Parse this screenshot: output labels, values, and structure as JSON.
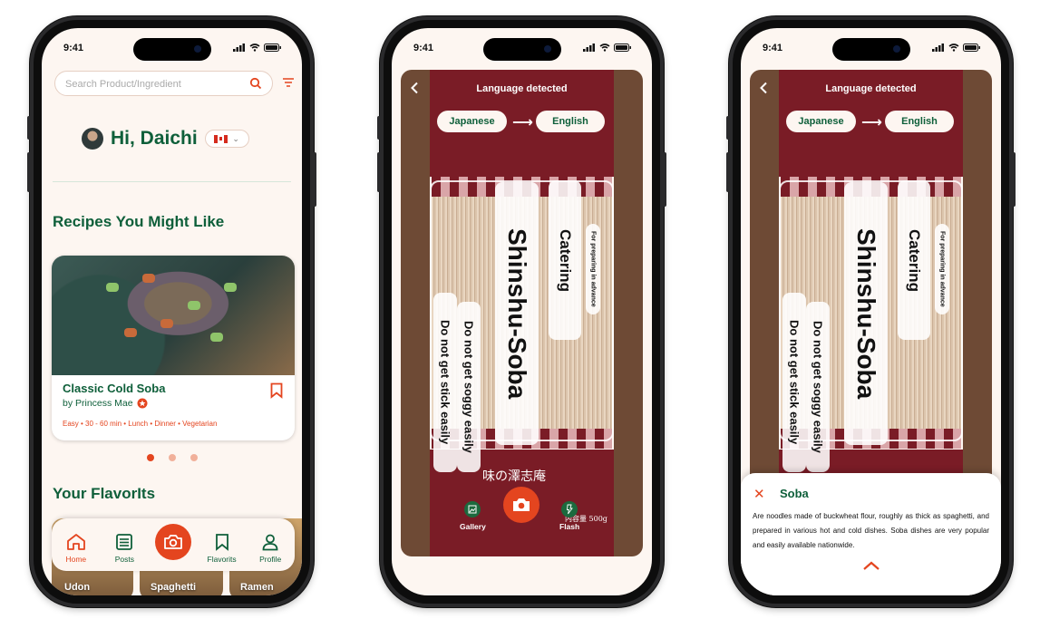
{
  "status": {
    "time": "9:41"
  },
  "home": {
    "search_placeholder": "Search Product/Ingredient",
    "greeting": "Hi, Daichi",
    "recipes_title": "Recipes You Might Like",
    "recipe": {
      "title": "Classic Cold Soba",
      "author": "by Princess Mae",
      "tags": "Easy • 30 - 60 min • Lunch • Dinner • Vegetarian"
    },
    "carousel": {
      "count": 3,
      "active_index": 0
    },
    "favorites_title": "Your FlavorIts",
    "favorites": [
      "Udon",
      "Spaghetti",
      "Ramen"
    ],
    "tabs": [
      {
        "label": "Home",
        "icon": "home-icon",
        "active": true
      },
      {
        "label": "Posts",
        "icon": "posts-icon",
        "active": false
      },
      {
        "label": "",
        "icon": "camera-icon",
        "active": false
      },
      {
        "label": "Flavorits",
        "icon": "bookmark-icon",
        "active": false
      },
      {
        "label": "Profile",
        "icon": "profile-icon",
        "active": false
      }
    ]
  },
  "camera": {
    "title": "Language detected",
    "from_lang": "Japanese",
    "to_lang": "English",
    "translations": {
      "main": "Shinshu-Soba",
      "catering": "Catering",
      "advance": "For preparing in advance",
      "soggy": "Do not get soggy easily",
      "stick": "Do not get stick easily"
    },
    "package_brand": "味の澤志庵",
    "package_weight": "内容量 500g",
    "gallery_label": "Gallery",
    "flash_label": "Flash"
  },
  "definition": {
    "term": "Soba",
    "text": "Are noodles made of buckwheat flour, roughly as thick as spaghetti, and prepared in various hot and cold dishes. Soba dishes are very popular and easily available nationwide."
  },
  "colors": {
    "brand_green": "#0e5f3a",
    "accent_orange": "#e4451f",
    "background": "#fdf6f1"
  }
}
